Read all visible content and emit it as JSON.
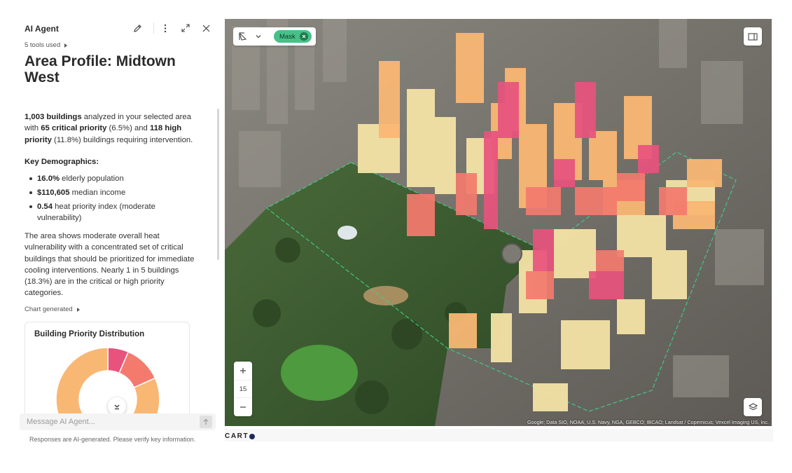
{
  "panel": {
    "title": "AI Agent",
    "tools_used": "5 tools used",
    "area_title": "Area Profile: Midtown West",
    "summary": {
      "buildings_count": "1,003 buildings",
      "text1": " analyzed in your selected area with ",
      "critical": "65 critical priority",
      "text2": " (6.5%) and ",
      "high": "118 high priority",
      "text3": " (11.8%) buildings requiring intervention."
    },
    "demographics_heading": "Key Demographics:",
    "demographics": [
      {
        "value": "16.0%",
        "text": " elderly population"
      },
      {
        "value": "$110,605",
        "text": " median income"
      },
      {
        "value": "0.54",
        "text": " heat priority index (moderate vulnerability)"
      }
    ],
    "analysis": "The area shows moderate overall heat vulnerability with a concentrated set of critical buildings that should be prioritized for immediate cooling interventions. Nearly 1 in 5 buildings (18.3%) are in the critical or high priority categories.",
    "chart_generated": "Chart generated",
    "message_placeholder": "Message AI Agent...",
    "disclaimer": "Responses are AI-generated. Please verify key information."
  },
  "chart_data": {
    "type": "pie",
    "title": "Building Priority Distribution",
    "series": [
      {
        "values": [
          65,
          118,
          820
        ],
        "colors": [
          "#e8537e",
          "#f47a6e",
          "#f9b774"
        ]
      }
    ],
    "legend": "none"
  },
  "map": {
    "mask_label": "Mask",
    "zoom_level": "15",
    "attribution": "Google; Data SIO, NOAA, U.S. Navy, NGA, GEBCO; IBCAO; Landsat / Copernicus; Vexcel Imaging US, Inc.",
    "carto_logo": "CART"
  },
  "colors": {
    "mask_chip": "#47c08a",
    "critical": "#e8537e",
    "high": "#f47a6e",
    "moderate": "#f9b774",
    "low": "#f4e3a6",
    "park": "#3e6b32"
  },
  "icons": {
    "edit": "pencil-icon",
    "more": "kebab-icon",
    "expand": "expand-icon",
    "close": "close-icon",
    "draw": "polygon-draw-icon",
    "panel": "sidebar-panel-icon",
    "layers": "layers-icon",
    "scroll": "chevron-down-icon",
    "send": "arrow-up-icon"
  }
}
